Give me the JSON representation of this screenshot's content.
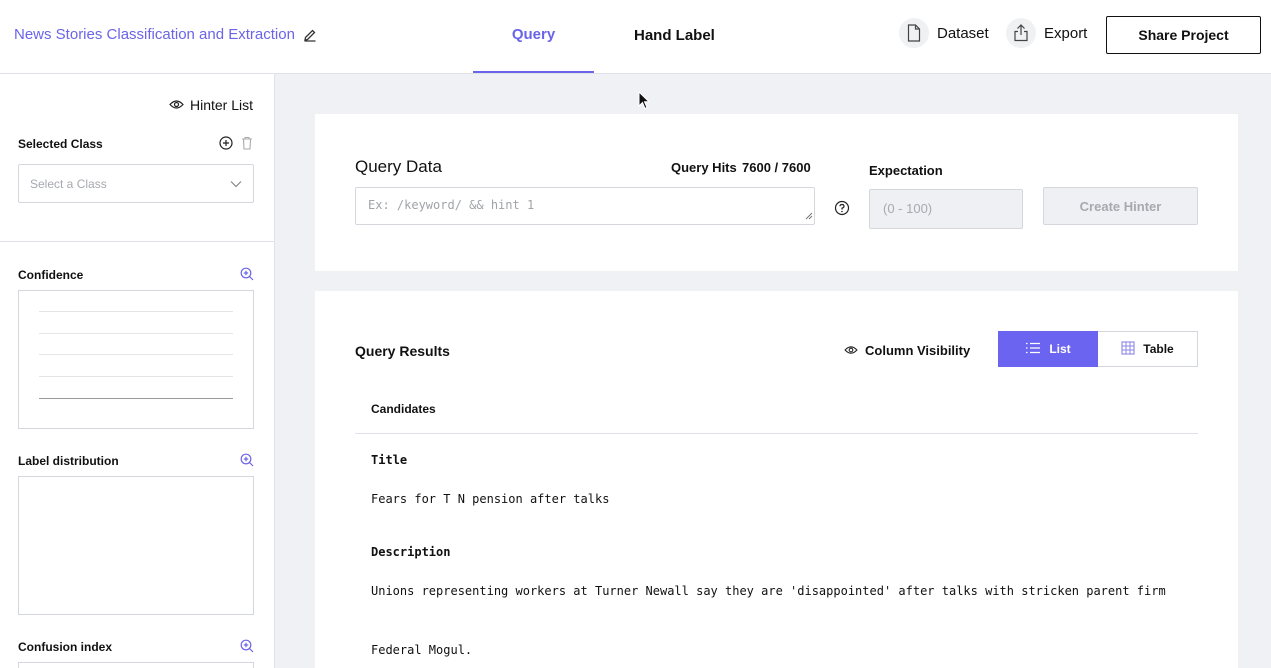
{
  "header": {
    "project_title": "News Stories Classification and Extraction",
    "tabs": [
      {
        "label": "Query",
        "active": true
      },
      {
        "label": "Hand Label",
        "active": false
      }
    ],
    "dataset_label": "Dataset",
    "export_label": "Export",
    "share_label": "Share Project"
  },
  "sidebar": {
    "hinter_list_label": "Hinter List",
    "selected_class_label": "Selected Class",
    "select_placeholder": "Select a Class",
    "sections": [
      {
        "label": "Confidence"
      },
      {
        "label": "Label distribution"
      },
      {
        "label": "Confusion index"
      }
    ]
  },
  "query": {
    "title": "Query Data",
    "hits_label": "Query Hits",
    "hits_value": "7600 / 7600",
    "input_placeholder": "Ex: /keyword/ && hint 1",
    "expectation_label": "Expectation",
    "expectation_placeholder": "(0 - 100)",
    "create_button": "Create Hinter"
  },
  "results": {
    "title": "Query Results",
    "column_visibility": "Column Visibility",
    "view_list": "List",
    "view_table": "Table",
    "candidates_label": "Candidates",
    "fields": [
      {
        "label": "Title",
        "value": "Fears for T N pension after talks"
      },
      {
        "label": "Description",
        "value": "Unions representing workers at Turner Newall say they are 'disappointed' after talks with stricken parent firm",
        "value2": "Federal Mogul."
      }
    ]
  },
  "colors": {
    "accent": "#6b64f0",
    "link": "#6b64e8"
  }
}
